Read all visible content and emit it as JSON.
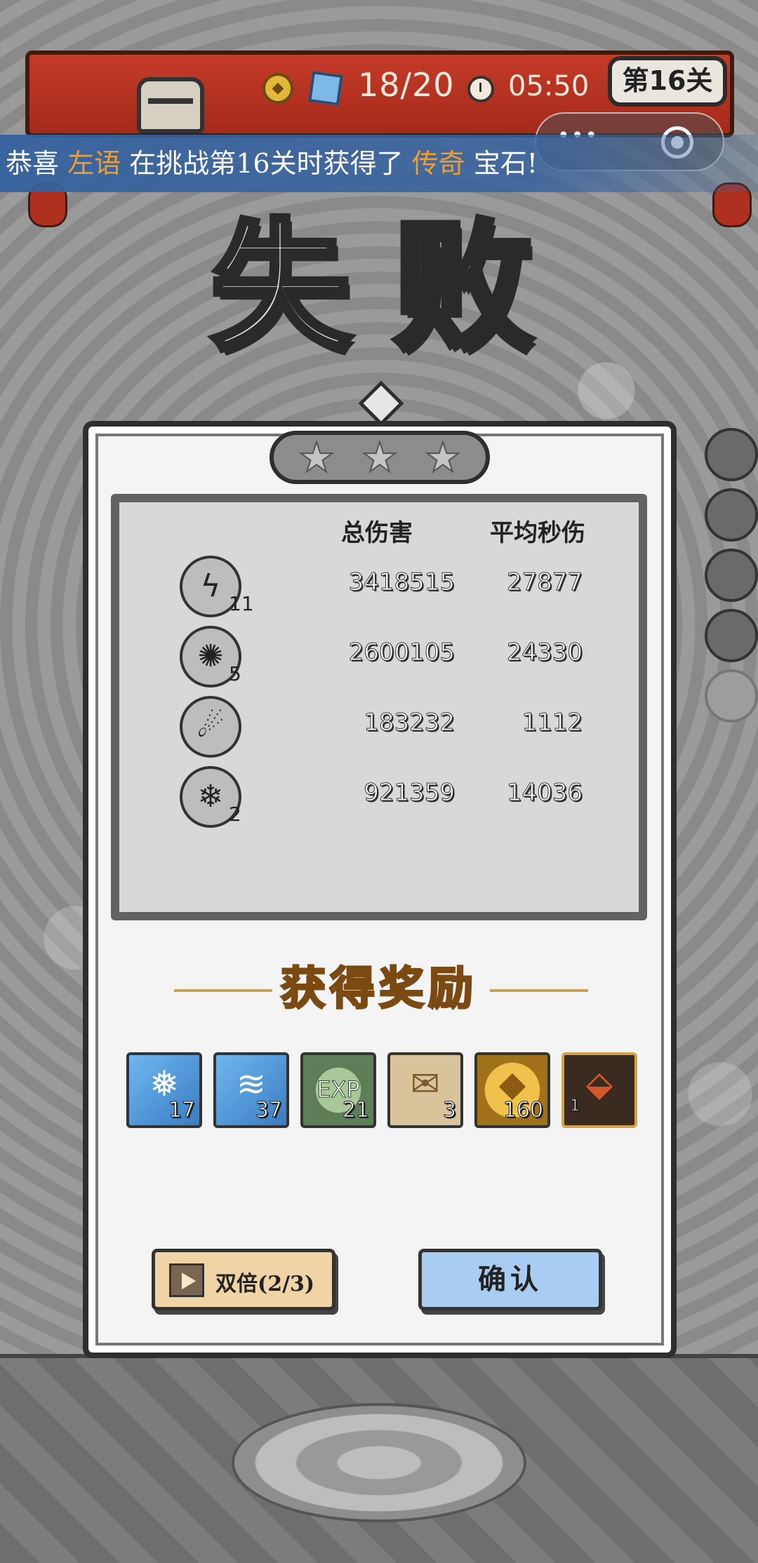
{
  "hud": {
    "stamina": "18/20",
    "timer": "05:50",
    "level": "第16关"
  },
  "capsule": {
    "more": "•••"
  },
  "banner": {
    "prefix": "恭喜",
    "player": "左语",
    "middle": "在挑战第16关时获得了",
    "item": "传奇",
    "suffix": "宝石!"
  },
  "result": {
    "title": "失败",
    "stars": 0,
    "headers": {
      "total": "总伤害",
      "dps": "平均秒伤"
    },
    "rows": [
      {
        "icon": "lightning-icon",
        "glyph": "ϟ",
        "level": "11",
        "total": "3418515",
        "dps": "27877"
      },
      {
        "icon": "black-hole-icon",
        "glyph": "✺",
        "level": "5",
        "total": "2600105",
        "dps": "24330"
      },
      {
        "icon": "meteor-icon",
        "glyph": "☄",
        "level": "",
        "total": "183232",
        "dps": "1112"
      },
      {
        "icon": "crystal-icon",
        "glyph": "❄",
        "level": "2",
        "total": "921359",
        "dps": "14036"
      }
    ]
  },
  "rewards": {
    "title": "获得奖励",
    "items": [
      {
        "icon": "ice-gem-icon",
        "glyph": "❅",
        "qty": "17"
      },
      {
        "icon": "water-gem-icon",
        "glyph": "≋",
        "qty": "37"
      },
      {
        "icon": "exp-icon",
        "glyph": "EXP",
        "qty": "21"
      },
      {
        "icon": "scroll-icon",
        "glyph": "✉",
        "qty": "3"
      },
      {
        "icon": "gold-coin-icon",
        "glyph": "◆",
        "qty": "160"
      },
      {
        "icon": "red-crystal-icon",
        "glyph": "⬙",
        "qty": "1"
      }
    ]
  },
  "buttons": {
    "double": "双倍(2/3)",
    "confirm": "确认"
  },
  "colors": {
    "banner_highlight": "#f29c2b",
    "reward_title": "#f6c45a",
    "confirm_button": "#a9cdf2",
    "double_button": "#f1d4a6"
  }
}
